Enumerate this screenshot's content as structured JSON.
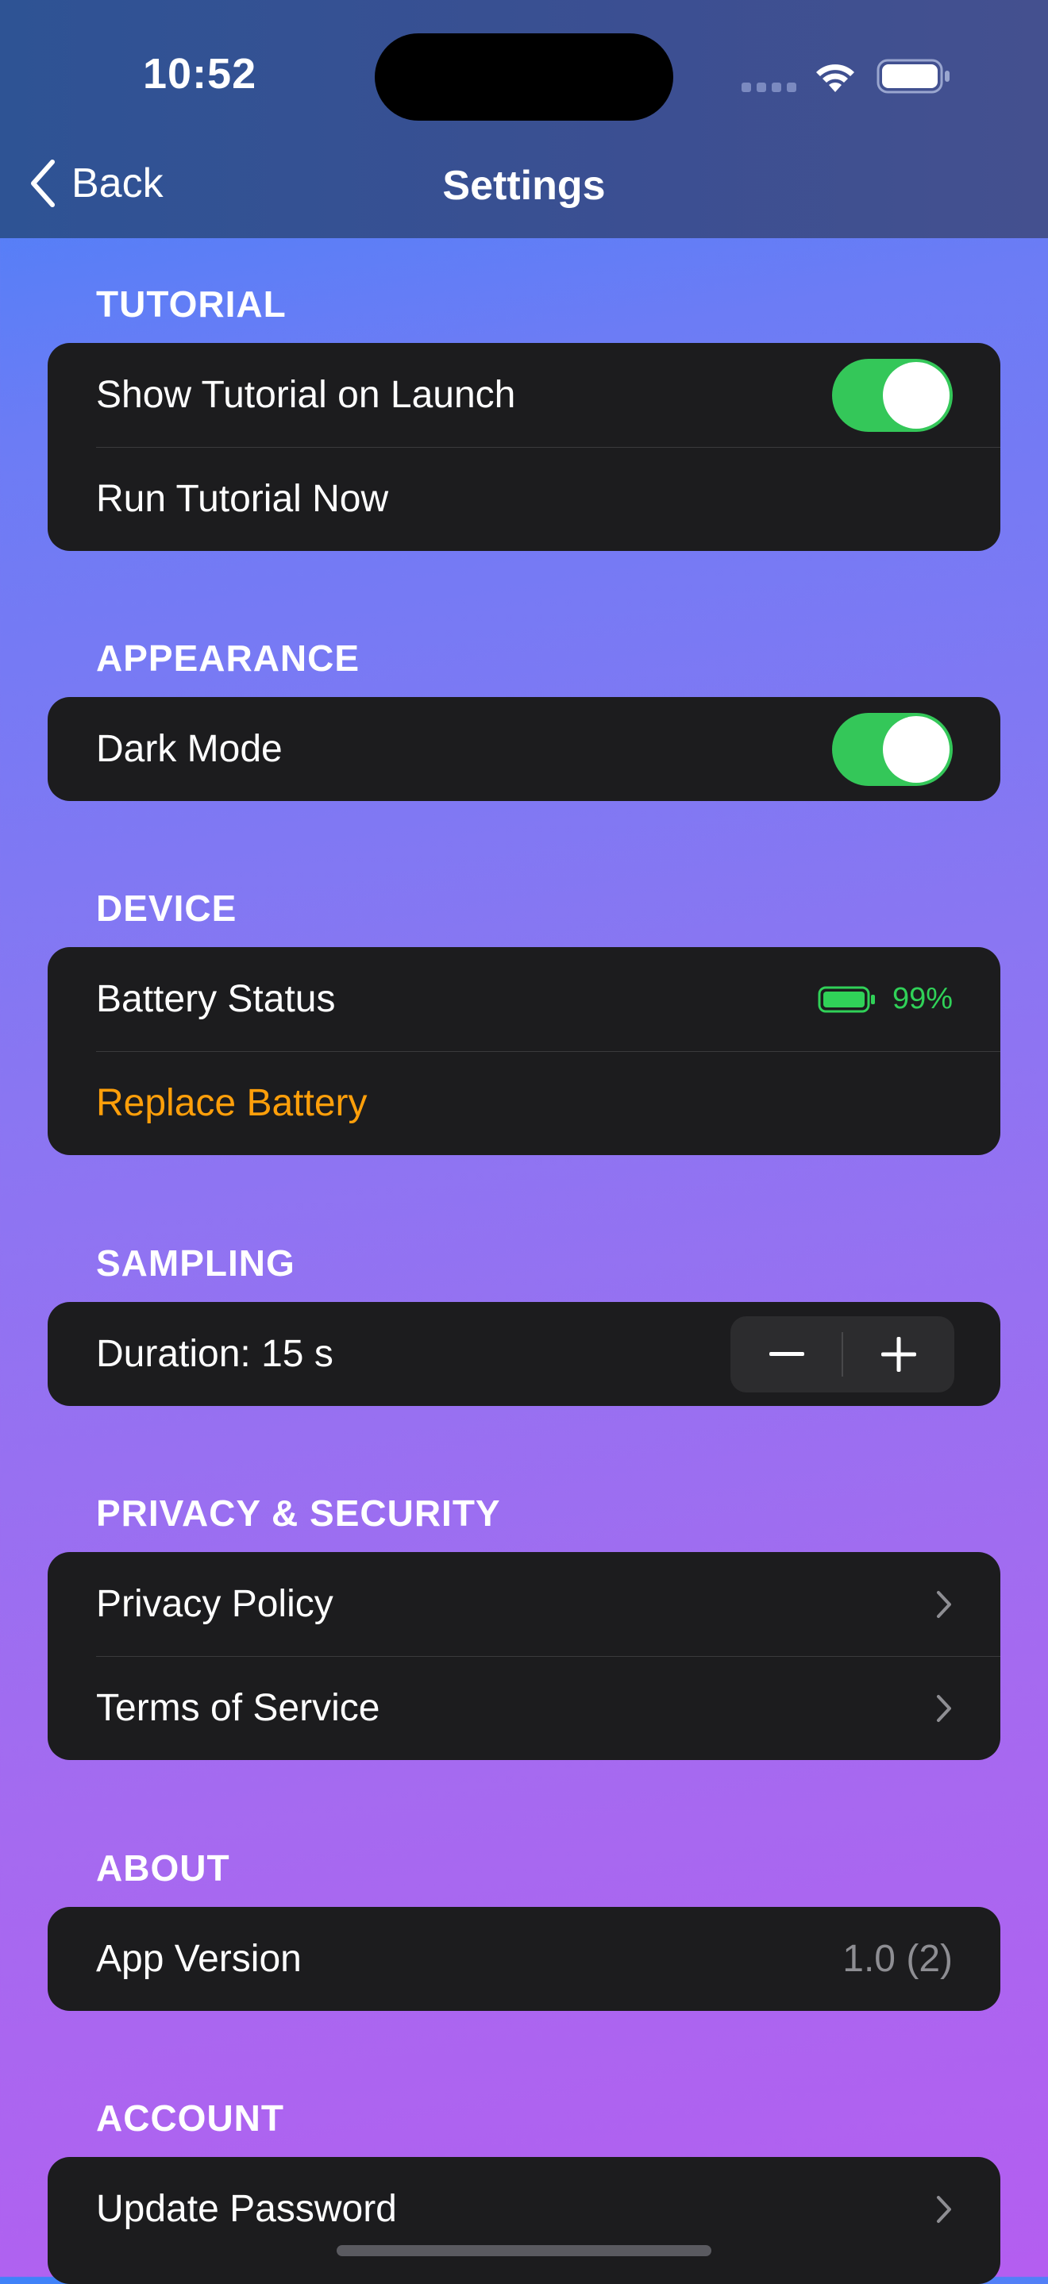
{
  "status_bar": {
    "time": "10:52"
  },
  "nav": {
    "back_label": "Back",
    "title": "Settings"
  },
  "sections": {
    "tutorial": {
      "header": "TUTORIAL",
      "show_on_launch": {
        "label": "Show Tutorial on Launch",
        "on": true
      },
      "run_now": {
        "label": "Run Tutorial Now"
      }
    },
    "appearance": {
      "header": "APPEARANCE",
      "dark_mode": {
        "label": "Dark Mode",
        "on": true
      }
    },
    "device": {
      "header": "DEVICE",
      "battery_status": {
        "label": "Battery Status",
        "value": "99%",
        "level": 0.99
      },
      "replace_battery": {
        "label": "Replace Battery"
      }
    },
    "sampling": {
      "header": "SAMPLING",
      "duration": {
        "label": "Duration: 15 s",
        "decrement": "−",
        "increment": "+"
      }
    },
    "privacy": {
      "header": "PRIVACY & SECURITY",
      "privacy_policy": {
        "label": "Privacy Policy"
      },
      "terms": {
        "label": "Terms of Service"
      }
    },
    "about": {
      "header": "ABOUT",
      "app_version": {
        "label": "App Version",
        "value": "1.0 (2)"
      }
    },
    "account": {
      "header": "ACCOUNT",
      "update_password": {
        "label": "Update Password"
      }
    }
  },
  "colors": {
    "toggle_on": "#34c759",
    "battery_green": "#30d158",
    "destructive_orange": "#ff9f0a",
    "card_bg": "#1c1c1e"
  },
  "icons": [
    "back-chevron-icon",
    "wifi-icon",
    "battery-icon",
    "chevron-right-icon",
    "minus-icon",
    "plus-icon"
  ]
}
